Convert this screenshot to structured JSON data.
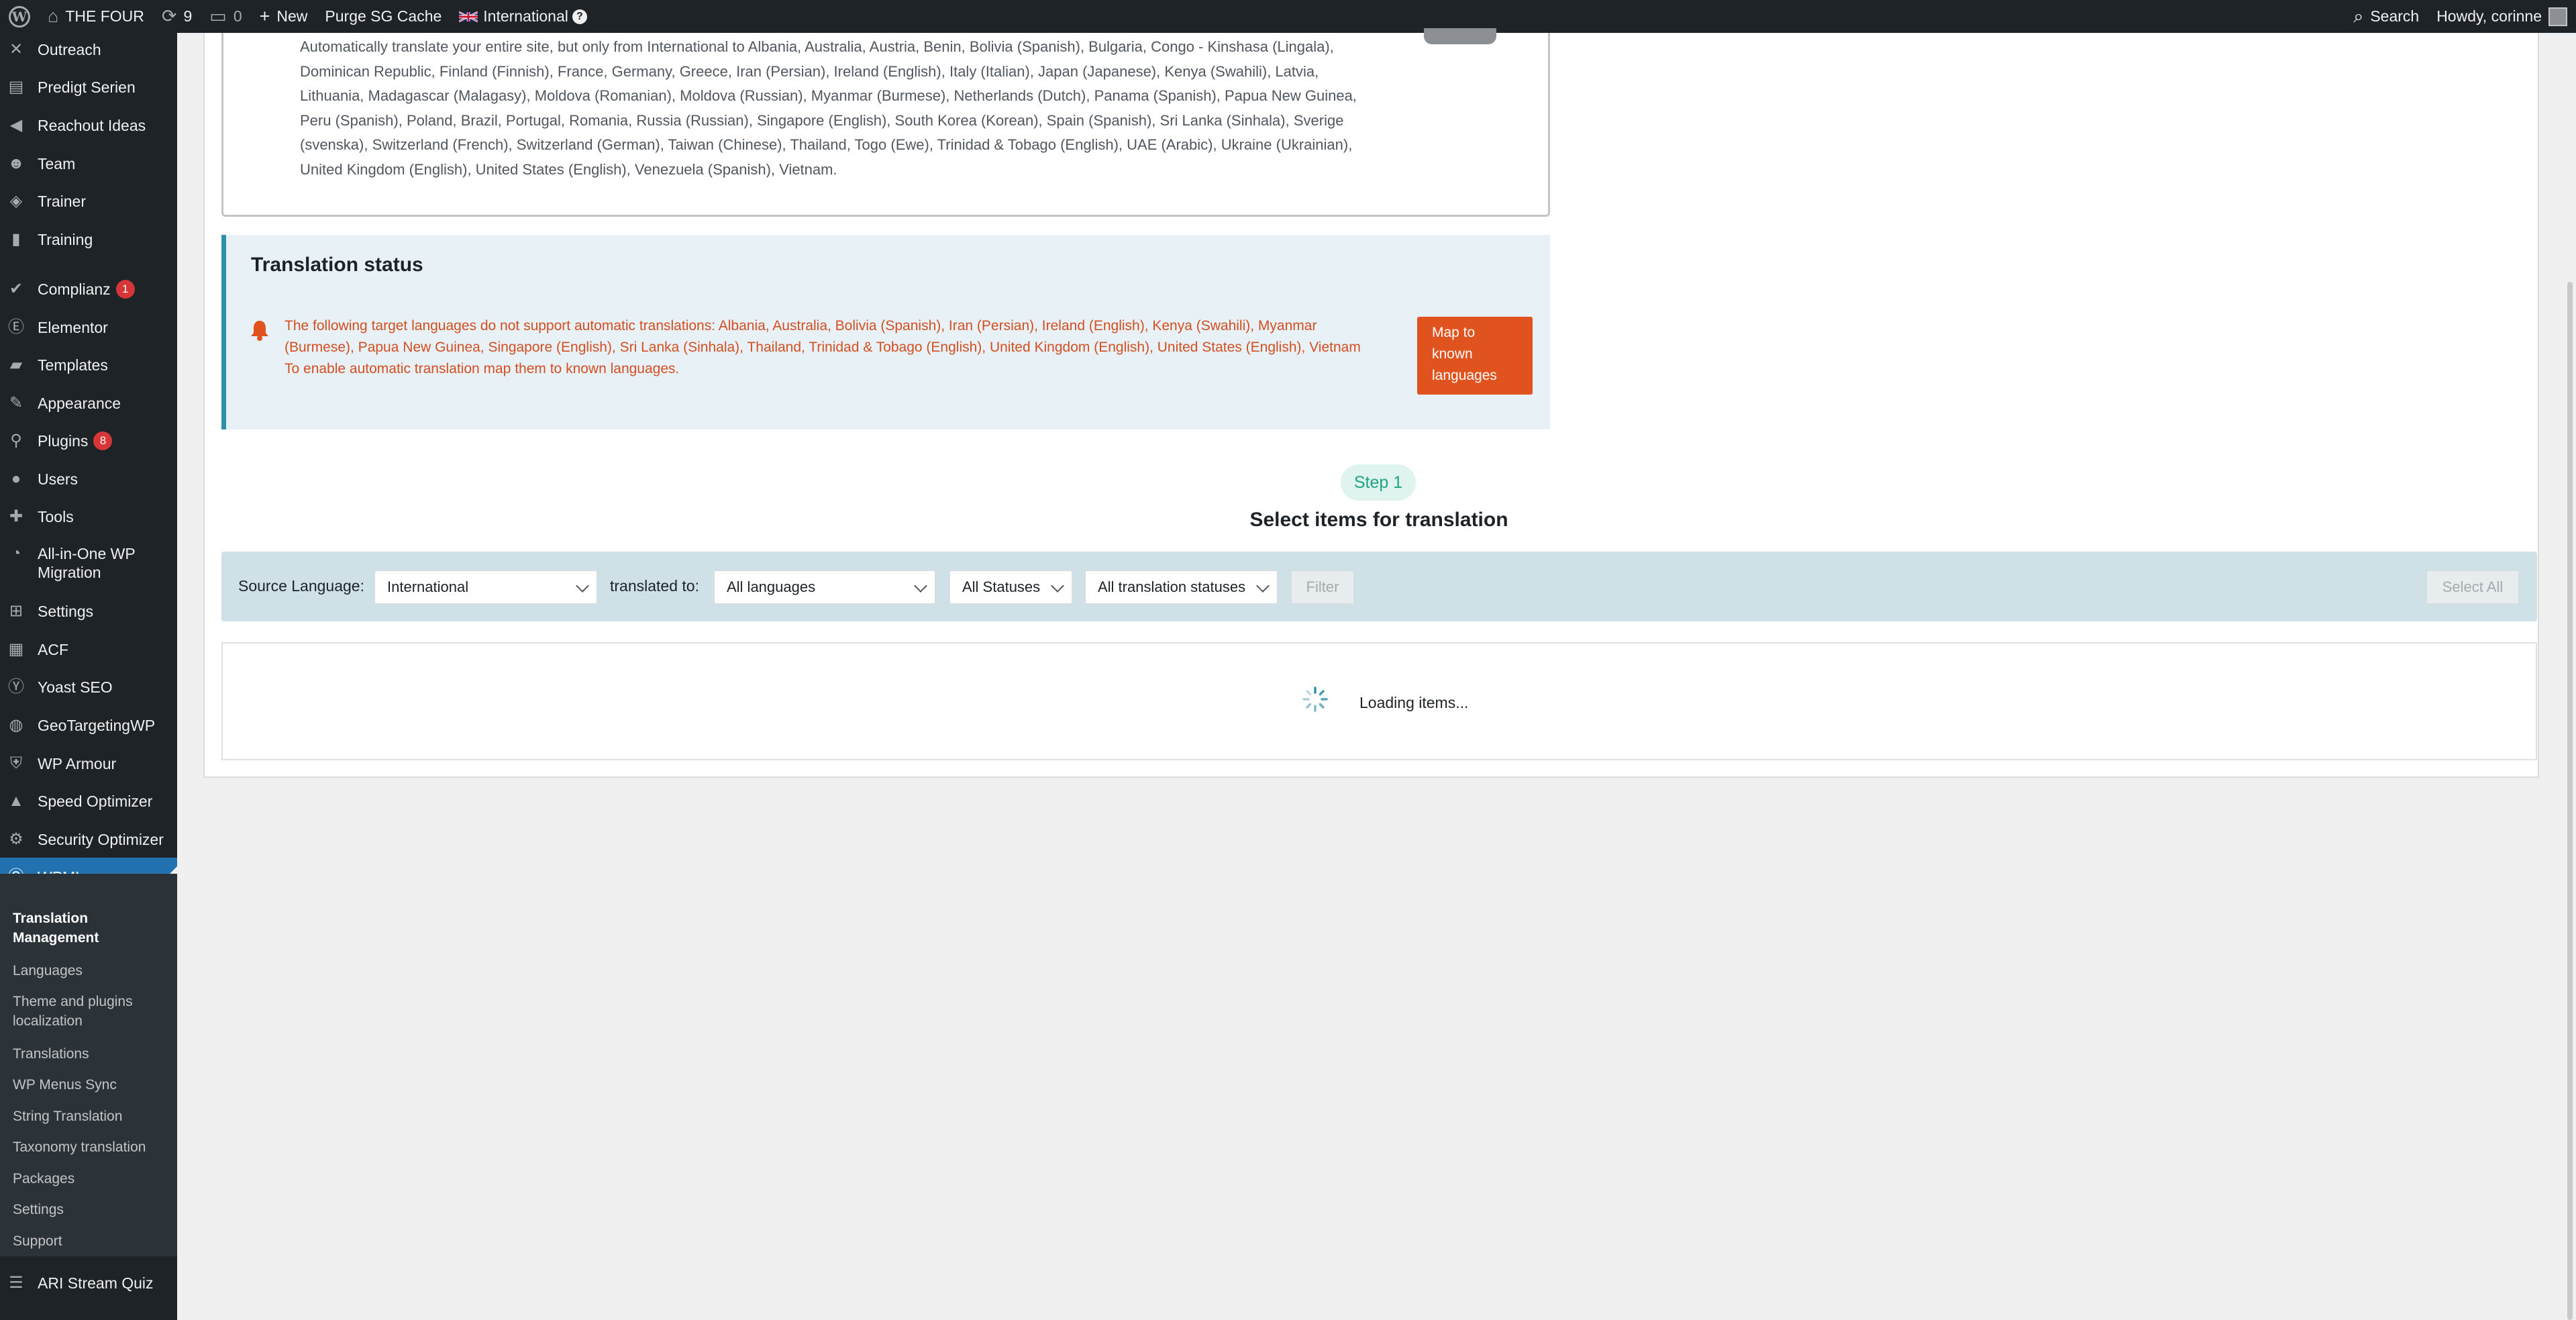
{
  "admin_bar": {
    "site_name": "THE FOUR",
    "updates_count": "9",
    "comments_count": "0",
    "new_label": "New",
    "purge_label": "Purge SG Cache",
    "language_label": "International",
    "search_label": "Search",
    "howdy_label": "Howdy, corinne"
  },
  "sidebar": {
    "items": [
      {
        "label": "Outreach",
        "icon": "outreach-icon"
      },
      {
        "label": "Predigt Serien",
        "icon": "document-icon"
      },
      {
        "label": "Reachout Ideas",
        "icon": "megaphone-icon"
      },
      {
        "label": "Team",
        "icon": "team-icon"
      },
      {
        "label": "Trainer",
        "icon": "tag-icon"
      },
      {
        "label": "Training",
        "icon": "book-icon"
      },
      {
        "label": "Complianz",
        "icon": "check-icon",
        "badge": "1"
      },
      {
        "label": "Elementor",
        "icon": "elementor-icon"
      },
      {
        "label": "Templates",
        "icon": "folder-icon"
      },
      {
        "label": "Appearance",
        "icon": "brush-icon"
      },
      {
        "label": "Plugins",
        "icon": "plugin-icon",
        "badge": "8"
      },
      {
        "label": "Users",
        "icon": "user-icon"
      },
      {
        "label": "Tools",
        "icon": "wrench-icon"
      },
      {
        "label": "All-in-One WP Migration",
        "icon": "migration-icon"
      },
      {
        "label": "Settings",
        "icon": "settings-icon"
      },
      {
        "label": "ACF",
        "icon": "table-icon"
      },
      {
        "label": "Yoast SEO",
        "icon": "yoast-icon"
      },
      {
        "label": "GeoTargetingWP",
        "icon": "globe-icon"
      },
      {
        "label": "WP Armour",
        "icon": "shield-icon"
      },
      {
        "label": "Speed Optimizer",
        "icon": "speed-icon"
      },
      {
        "label": "Security Optimizer",
        "icon": "lock-icon"
      },
      {
        "label": "WPML",
        "icon": "wpml-icon"
      },
      {
        "label": "ARI Stream Quiz",
        "icon": "quiz-icon"
      }
    ],
    "wpml_submenu": [
      "Translation Management",
      "Languages",
      "Theme and plugins localization",
      "Translations",
      "WP Menus Sync",
      "String Translation",
      "Taxonomy translation",
      "Packages",
      "Settings",
      "Support"
    ]
  },
  "auto_translate": {
    "text": "Automatically translate your entire site, but only from International to Albania, Australia, Austria, Benin, Bolivia (Spanish), Bulgaria, Congo - Kinshasa (Lingala), Dominican Republic, Finland (Finnish), France, Germany, Greece, Iran (Persian), Ireland (English), Italy (Italian), Japan (Japanese), Kenya (Swahili), Latvia, Lithuania, Madagascar (Malagasy), Moldova (Romanian), Moldova (Russian), Myanmar (Burmese), Netherlands (Dutch), Panama (Spanish), Papua New Guinea, Peru (Spanish), Poland, Brazil, Portugal, Romania, Russia (Russian), Singapore (English), South Korea (Korean), Spain (Spanish), Sri Lanka (Sinhala), Sverige (svenska), Switzerland (French), Switzerland (German), Taiwan (Chinese), Thailand, Togo (Ewe), Trinidad & Tobago (English), UAE (Arabic), Ukraine (Ukrainian), United Kingdom (English), United States (English), Venezuela (Spanish), Vietnam."
  },
  "translation_status": {
    "title": "Translation status",
    "warning": "The following target languages do not support automatic translations: Albania, Australia, Bolivia (Spanish), Iran (Persian), Ireland (English), Kenya (Swahili), Myanmar (Burmese), Papua New Guinea, Singapore (English), Sri Lanka (Sinhala), Thailand, Trinidad & Tobago (English), United Kingdom (English), United States (English), Vietnam",
    "hint": "To enable automatic translation map them to known languages.",
    "map_button": "Map to known languages",
    "accent_color": "#e0531f"
  },
  "step": {
    "label": "Step 1",
    "title": "Select items for translation"
  },
  "filters": {
    "source_label": "Source Language:",
    "source_value": "International",
    "translated_to_label": "translated to:",
    "target_value": "All languages",
    "status_value": "All Statuses",
    "translation_status_value": "All translation statuses",
    "filter_button": "Filter",
    "select_all_button": "Select All"
  },
  "items": {
    "loading_text": "Loading items..."
  },
  "colors": {
    "admin_bar": "#1d2327",
    "active_menu": "#2271b1",
    "step_green": "#1fa383"
  }
}
